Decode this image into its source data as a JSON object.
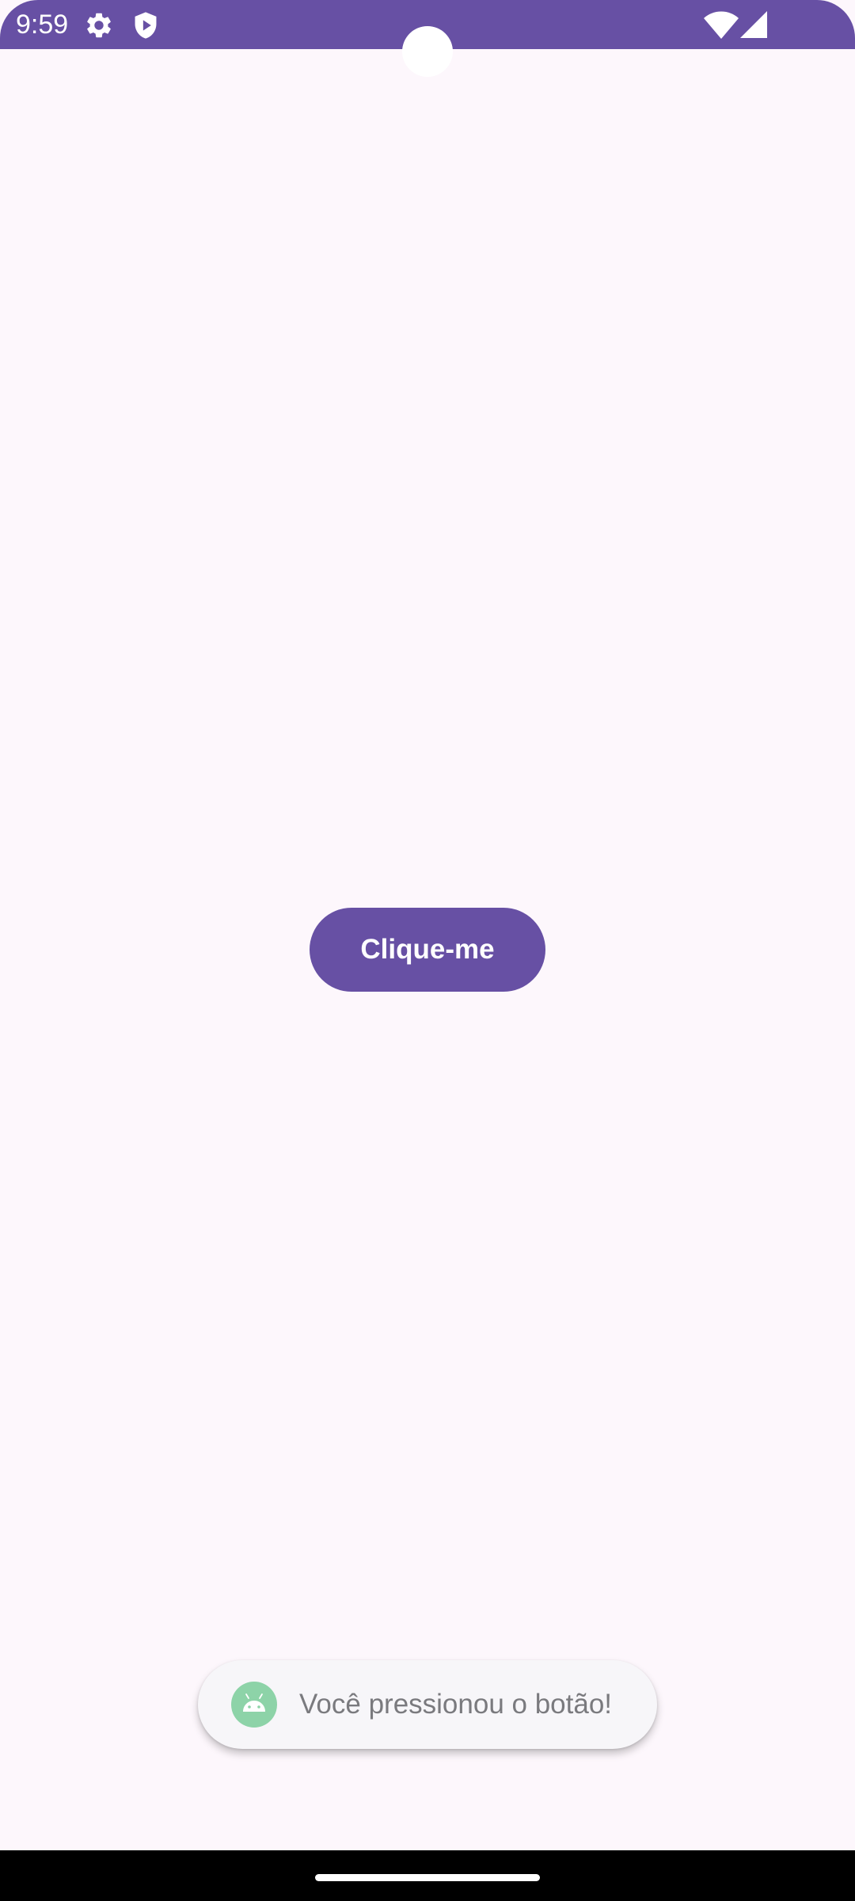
{
  "status_bar": {
    "time": "9:59",
    "background_color": "#6750A4",
    "left_icons": [
      "gear-icon",
      "shield-play-icon"
    ],
    "right_icons": [
      "wifi-icon",
      "signal-icon"
    ]
  },
  "main": {
    "button_label": "Clique-me",
    "button_color": "#6750A4",
    "background_color": "#FDF7FC"
  },
  "toast": {
    "icon": "android-icon",
    "message": "Você pressionou o botão!"
  },
  "navigation": {
    "handle": "gesture-handle"
  }
}
